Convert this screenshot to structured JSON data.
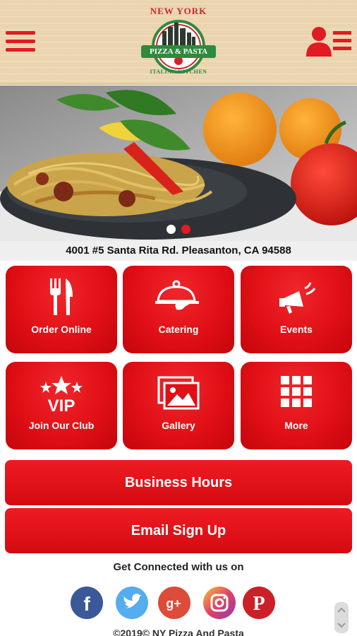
{
  "header": {
    "logo": {
      "title": "NEW YORK",
      "banner": "PIZZA & PASTA",
      "subtitle": "ITALIAN KITCHEN"
    }
  },
  "hero": {
    "slides": 2,
    "active_slide": 2
  },
  "address": "4001 #5 Santa Rita Rd. Pleasanton, CA 94588",
  "tiles": [
    {
      "label": "Order Online",
      "icon": "fork-knife-icon"
    },
    {
      "label": "Catering",
      "icon": "cloche-icon"
    },
    {
      "label": "Events",
      "icon": "megaphone-icon"
    },
    {
      "label": "Join Our Club",
      "icon": "vip-stars-icon"
    },
    {
      "label": "Gallery",
      "icon": "gallery-icon"
    },
    {
      "label": "More",
      "icon": "grid-icon"
    }
  ],
  "business_hours_label": "Business Hours",
  "email_signup_label": "Email Sign Up",
  "connect_label": "Get Connected with us on",
  "social": [
    {
      "name": "facebook",
      "color": "#3b5998"
    },
    {
      "name": "twitter",
      "color": "#55acee"
    },
    {
      "name": "google-plus",
      "color": "#dd4b39"
    },
    {
      "name": "instagram",
      "color": "#c13584"
    },
    {
      "name": "pinterest",
      "color": "#cb2027"
    }
  ],
  "footer": "©2019© NY Pizza And Pasta",
  "colors": {
    "brand_red": "#e01b22",
    "logo_green": "#2f8a3c"
  }
}
